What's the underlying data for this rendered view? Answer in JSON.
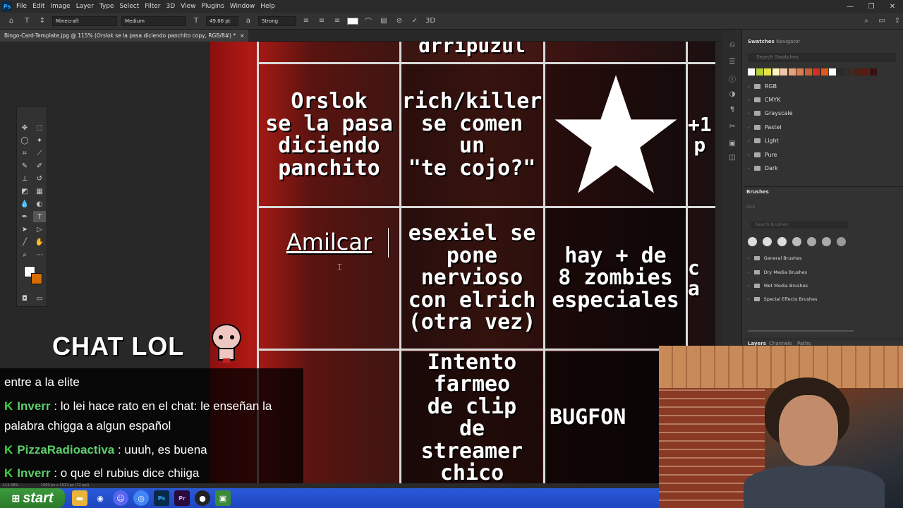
{
  "menubar": {
    "app_icon": "Ps",
    "items": [
      "File",
      "Edit",
      "Image",
      "Layer",
      "Type",
      "Select",
      "Filter",
      "3D",
      "View",
      "Plugins",
      "Window",
      "Help"
    ],
    "window_controls": [
      "—",
      "❐",
      "✕"
    ]
  },
  "options": {
    "font_family": "Minecraft",
    "font_style": "Medium",
    "font_size": "49.66 pt",
    "antialias": "Strong",
    "text_color": "#ffffff"
  },
  "document": {
    "tab_title": "Bingo-Card-Template.jpg @ 115% (Orslok se la pasa diciendo  panchito copy, RGB/8#) *",
    "tab_close": "×"
  },
  "status": {
    "zoom": "115.08%",
    "size": "1500 px x 1913 px (72 ppi)"
  },
  "bingo": {
    "partial_top": "drripuzul",
    "cell_1": "Orslok\nse la pasa\ndiciendo\npanchito",
    "cell_2": "rich/killer\nse comen\nun\n\"te cojo?\"",
    "cell_4_partial": "+1\np",
    "cell_5": "Amilcar",
    "cell_6": "esexiel se\npone\nnervioso\ncon elrich\n(otra vez)",
    "cell_7": "hay + de\n8 zombies\nespeciales",
    "cell_8_partial": "c\na",
    "cell_9": "Intento\nfarmeo\nde clip\nde\nstreamer\nchico",
    "cell_10": "BUGFON"
  },
  "panels": {
    "tab_swatches": "Swatches",
    "tab_navigator": "Navigator",
    "search_swatches": "Search Swatches",
    "swatch_colors": [
      "#ffffff",
      "#b3d234",
      "#e8e24a",
      "#fff7c0",
      "#f4c7a6",
      "#e7a07a",
      "#d68050",
      "#c86030",
      "#d03020",
      "#e05818",
      "#ffffff",
      "#2a2a2a",
      "#3a2a22",
      "#4a2016",
      "#5a1a10",
      "#3a1010"
    ],
    "folders": [
      "RGB",
      "CMYK",
      "Grayscale",
      "Pastel",
      "Light",
      "Pure",
      "Dark"
    ],
    "brushes_title": "Brushes",
    "brush_size_label": "Size",
    "search_brushes": "Search Brushes",
    "brush_folders": [
      "General Brushes",
      "Dry Media Brushes",
      "Wet Media Brushes",
      "Special Effects Brushes"
    ],
    "bottom_tabs": [
      "Layers",
      "Channels",
      "Paths"
    ]
  },
  "overlay": {
    "chat_title": "CHAT LOL",
    "messages": [
      {
        "user": "",
        "text": "entre a la elite"
      },
      {
        "user": "Inverr",
        "text": "lo lei hace rato en el chat: le enseñan la palabra chigga a algun español"
      },
      {
        "user": "PizzaRadioactiva",
        "text": "uuuh, es buena"
      },
      {
        "user": "Inverr",
        "text": "o que el rubius dice chiiga"
      }
    ]
  },
  "taskbar": {
    "start_label": "start",
    "icons": [
      "folder-icon",
      "steam-icon",
      "discord-icon",
      "chrome-icon",
      "photoshop-icon",
      "premiere-icon",
      "obs-icon",
      "app-icon"
    ]
  }
}
